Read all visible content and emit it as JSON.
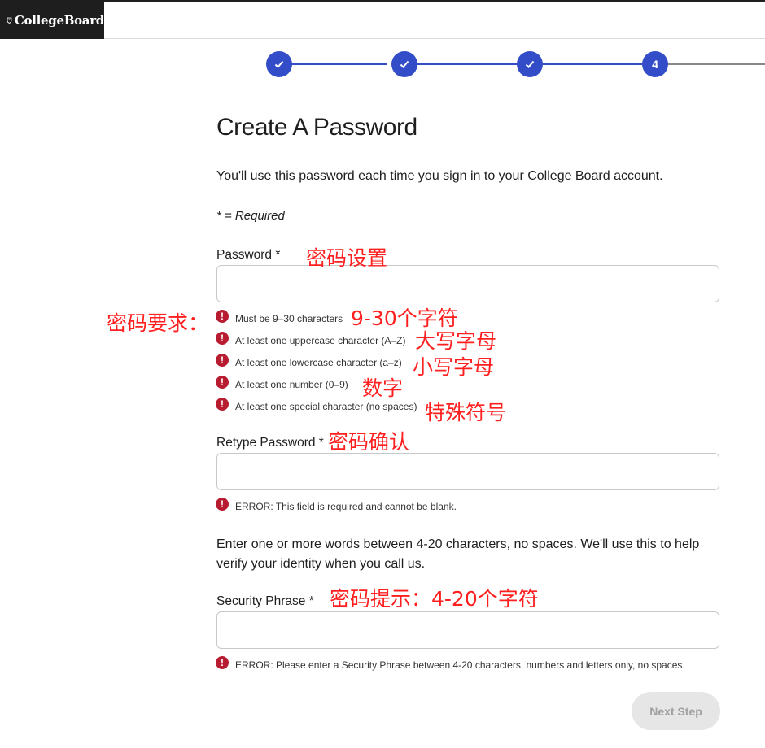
{
  "header": {
    "logo_text": "CollegeBoard"
  },
  "stepper": {
    "steps": [
      "",
      "",
      "",
      "4"
    ]
  },
  "page": {
    "title": "Create A Password",
    "intro": "You'll use this password each time you sign in to your College Board account.",
    "required_note": "* = Required"
  },
  "password": {
    "label": "Password *",
    "value": "",
    "requirements": [
      "Must be 9–30 characters",
      "At least one uppercase character (A–Z)",
      "At least one lowercase character (a–z)",
      "At least one number (0–9)",
      "At least one special character (no spaces)"
    ]
  },
  "retype": {
    "label": "Retype Password *",
    "value": "",
    "error": "ERROR: This field is required and cannot be blank."
  },
  "security": {
    "instructions": "Enter one or more words between 4-20 characters, no spaces. We'll use this to help verify your identity when you call us.",
    "label": "Security Phrase *",
    "value": "",
    "error": "ERROR: Please enter a Security Phrase between 4-20 characters, numbers and letters only, no spaces."
  },
  "next_button": "Next Step",
  "annotations": {
    "password_setting": "密码设置",
    "requirements_title": "密码要求：",
    "length": "9-30个字符",
    "uppercase": "大写字母",
    "lowercase": "小写字母",
    "digit": "数字",
    "special": "特殊符号",
    "confirm": "密码确认",
    "hint": "密码提示：4-20个字符"
  },
  "colors": {
    "accent": "#324dc7",
    "error": "#b71c31",
    "annotation": "#ff1f1f"
  }
}
